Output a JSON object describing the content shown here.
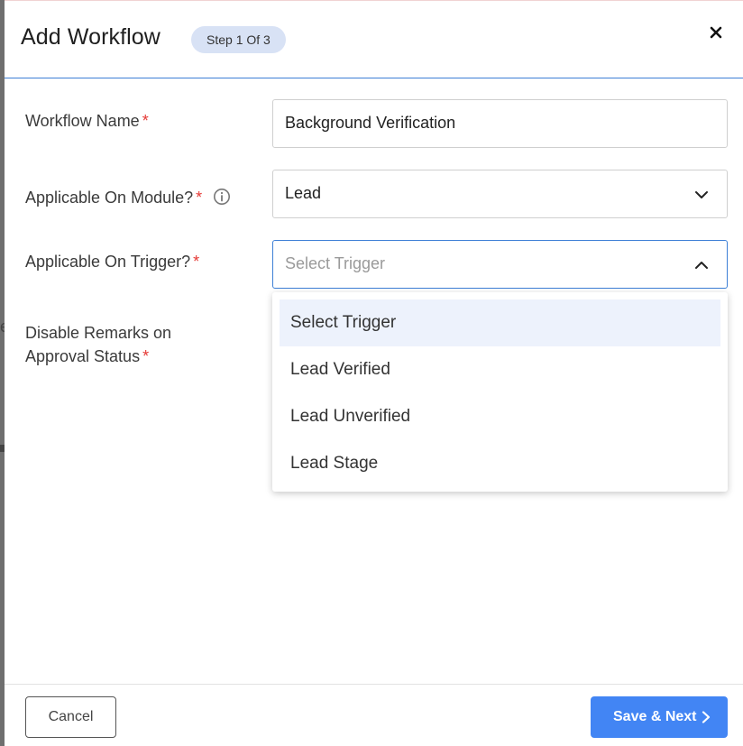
{
  "header": {
    "title": "Add Workflow",
    "step": "Step 1 Of 3",
    "close_icon": "close-icon"
  },
  "form": {
    "workflow_name": {
      "label": "Workflow Name",
      "required_mark": "*",
      "value": "Background Verification"
    },
    "module": {
      "label": "Applicable On Module?",
      "required_mark": "*",
      "value": "Lead",
      "info_icon": "info-icon",
      "chevron_icon": "chevron-down-icon"
    },
    "trigger": {
      "label": "Applicable On Trigger?",
      "required_mark": "*",
      "placeholder": "Select Trigger",
      "chevron_icon": "chevron-up-icon",
      "expanded": true
    },
    "disable_remarks": {
      "label_line1": "Disable Remarks on",
      "label_line2": "Approval Status",
      "required_mark": "*"
    }
  },
  "dropdown": {
    "options": [
      "Select Trigger",
      "Lead Verified",
      "Lead Unverified",
      "Lead Stage"
    ],
    "highlighted_option": "Select Trigger"
  },
  "background": {
    "partial_text": "e"
  },
  "footer": {
    "cancel_label": "Cancel",
    "save_label": "Save & Next",
    "save_icon": "chevron-right-icon"
  },
  "colors": {
    "primary": "#4285f4",
    "required": "#e53935",
    "badge_bg": "#d8e2f5",
    "option_highlight": "#edf2fc",
    "active_border": "#3d7fd6"
  }
}
